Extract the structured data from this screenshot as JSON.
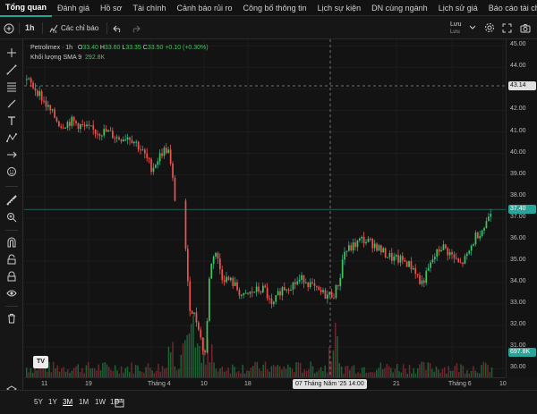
{
  "tabs": [
    "Tổng quan",
    "Đánh giá",
    "Hồ sơ",
    "Tài chính",
    "Cảnh báo rủi ro",
    "Công bố thông tin",
    "Lịch sự kiện",
    "DN cùng ngành",
    "Lịch sử giá",
    "Báo cáo tài chính"
  ],
  "toolbar": {
    "interval": "1h",
    "indicators_label": "Các chỉ báo",
    "save_label": "Lưu",
    "save_sub": "Lưu"
  },
  "legend": {
    "symbol": "Petrolimex · 1h",
    "open_label": "O",
    "open": "33.40",
    "high_label": "H",
    "high": "33.60",
    "low_label": "L",
    "low": "33.35",
    "close_label": "C",
    "close": "33.50",
    "change": "+0.10 (+0.30%)",
    "volume_label": "Khối lượng SMA 9",
    "volume_value": "292.8K"
  },
  "price_axis": {
    "ticks": [
      "45.00",
      "44.00",
      "43.00",
      "42.00",
      "41.00",
      "40.00",
      "39.00",
      "38.00",
      "37.00",
      "36.00",
      "35.00",
      "34.00",
      "33.00",
      "32.00",
      "31.00",
      "30.00"
    ],
    "crosshair_price": "43.14",
    "last_price": "37.40",
    "volume_tag": "697.8K"
  },
  "time_axis": {
    "ticks": [
      "11",
      "19",
      "Tháng 4",
      "10",
      "18",
      "21",
      "Tháng 6",
      "10"
    ],
    "crosshair_time": "07 Tháng Năm '25   14:00"
  },
  "timeframes": [
    "5Y",
    "1Y",
    "3M",
    "1M",
    "1W",
    "1D"
  ],
  "active_timeframe": "3M",
  "colors": {
    "up": "#26a69a",
    "up_bright": "#4caf50",
    "down": "#ef5350",
    "background": "#131313",
    "accent": "#26a69a"
  },
  "chart_data": {
    "type": "candlestick",
    "y_range": [
      29.6,
      45.3
    ],
    "price_path": [
      [
        0,
        43.5
      ],
      [
        14,
        42.9
      ],
      [
        26,
        42.1
      ],
      [
        40,
        41.3
      ],
      [
        52,
        41.5
      ],
      [
        66,
        41.2
      ],
      [
        80,
        41.0
      ],
      [
        92,
        41.0
      ],
      [
        104,
        40.7
      ],
      [
        116,
        40.8
      ],
      [
        124,
        40.5
      ],
      [
        134,
        39.9
      ],
      [
        142,
        39.3
      ],
      [
        148,
        39.7
      ],
      [
        154,
        40.1
      ],
      [
        160,
        40.2
      ],
      [
        166,
        38.5
      ],
      [
        169,
        37.4
      ],
      [
        174,
        35.2
      ],
      [
        180,
        35.6
      ],
      [
        183,
        33.0
      ],
      [
        188,
        32.6
      ],
      [
        194,
        32.0
      ],
      [
        198,
        31.0
      ],
      [
        202,
        30.7
      ],
      [
        206,
        34.3
      ],
      [
        212,
        35.6
      ],
      [
        220,
        34.3
      ],
      [
        232,
        34.0
      ],
      [
        244,
        33.3
      ],
      [
        256,
        33.6
      ],
      [
        268,
        33.7
      ],
      [
        276,
        32.8
      ],
      [
        286,
        33.7
      ],
      [
        298,
        33.9
      ],
      [
        312,
        34.2
      ],
      [
        326,
        33.6
      ],
      [
        338,
        33.4
      ],
      [
        346,
        33.5
      ],
      [
        352,
        34.2
      ],
      [
        356,
        35.4
      ],
      [
        364,
        35.6
      ],
      [
        376,
        36.0
      ],
      [
        390,
        35.8
      ],
      [
        400,
        35.4
      ],
      [
        412,
        35.1
      ],
      [
        424,
        35.0
      ],
      [
        436,
        34.6
      ],
      [
        442,
        33.9
      ],
      [
        448,
        34.3
      ],
      [
        456,
        35.1
      ],
      [
        466,
        35.7
      ],
      [
        476,
        35.3
      ],
      [
        486,
        34.8
      ],
      [
        494,
        35.2
      ],
      [
        504,
        36.2
      ],
      [
        514,
        36.6
      ],
      [
        520,
        37.4
      ]
    ],
    "volume_tag": "697.8K",
    "last_price": 37.4,
    "crosshair_price": 43.14
  }
}
